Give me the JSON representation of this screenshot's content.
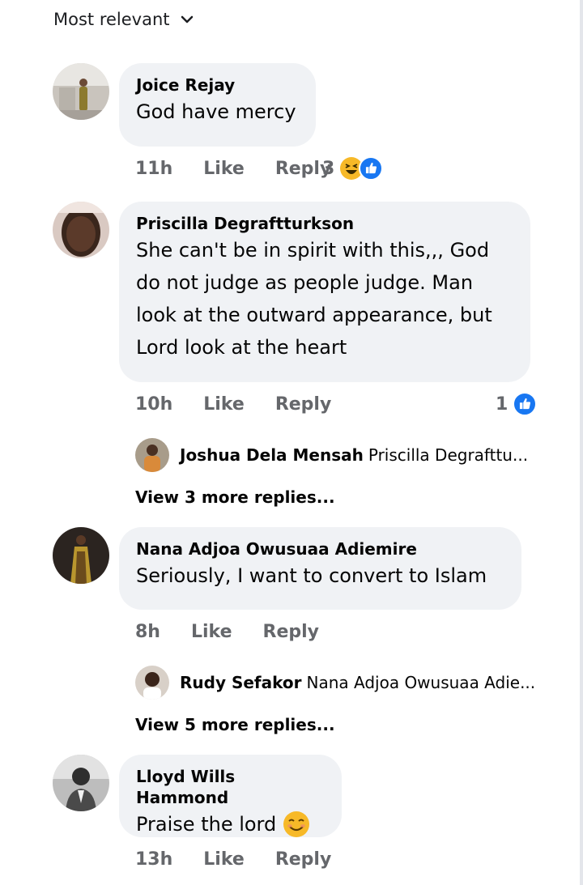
{
  "sort": {
    "label": "Most relevant",
    "icon": "chevron-down-icon"
  },
  "comments": [
    {
      "author": "Joice Rejay",
      "lines": [
        "God have mercy"
      ],
      "time": "11h",
      "like": "Like",
      "reply": "Reply",
      "reaction_count": "3",
      "reactions": [
        "haha-icon",
        "like-icon"
      ]
    },
    {
      "author": "Priscilla Degraftturkson",
      "lines": [
        "She can't  be in spirit with this,,,   God",
        "do not judge as people judge. Man",
        "look at the outward appearance, but",
        "Lord look at the heart"
      ],
      "time": "10h",
      "like": "Like",
      "reply": "Reply",
      "reaction_count": "1",
      "reactions": [
        "like-icon"
      ],
      "preview_reply": {
        "author": "Joshua Dela Mensah",
        "snippet": "Priscilla Degrafttu..."
      },
      "more_replies": "View 3 more replies..."
    },
    {
      "author": "Nana Adjoa Owusuaa Adiemire",
      "lines": [
        "Seriously, I want to convert to Islam"
      ],
      "time": "8h",
      "like": "Like",
      "reply": "Reply",
      "preview_reply": {
        "author": "Rudy Sefakor",
        "snippet": "Nana Adjoa Owusuaa Adie..."
      },
      "more_replies": "View 5 more replies..."
    },
    {
      "author": "Lloyd Wills Hammond",
      "lines": [
        "Praise the lord"
      ],
      "emoji": "smiling-face-icon",
      "time": "13h",
      "like": "Like",
      "reply": "Reply"
    }
  ],
  "colors": {
    "bubble": "#f0f2f5",
    "meta": "#65676b",
    "like_blue": "#1877f2",
    "emoji_yellow": "#f7b928"
  }
}
